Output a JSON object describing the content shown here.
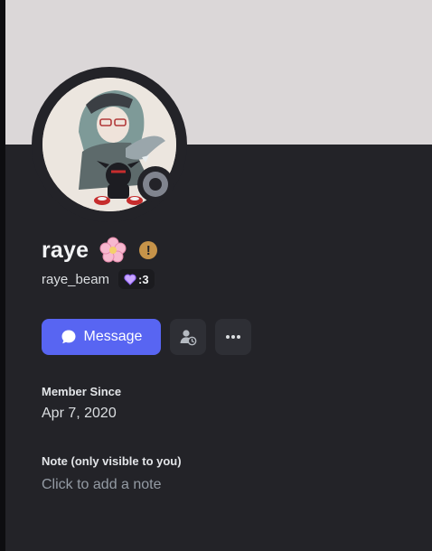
{
  "profile": {
    "display_name": "raye",
    "username": "raye_beam",
    "tag_text": ":3",
    "status": "offline"
  },
  "actions": {
    "message_label": "Message"
  },
  "member_since": {
    "label": "Member Since",
    "date": "Apr 7, 2020"
  },
  "note": {
    "label": "Note (only visible to you)",
    "placeholder": "Click to add a note"
  },
  "colors": {
    "panel_bg": "#232328",
    "banner": "#dbd7d8",
    "accent": "#5865f2",
    "warning": "#c69349",
    "status_offline": "#80848e"
  }
}
